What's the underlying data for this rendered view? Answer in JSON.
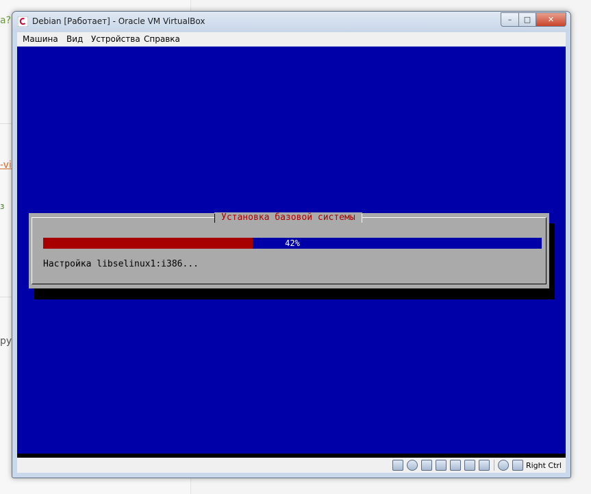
{
  "background": {
    "fragment_q": "а?",
    "fragment_link": "-vi",
    "fragment_g": "з",
    "fragment_ru": "ру"
  },
  "window": {
    "title": "Debian [Работает] - Oracle VM VirtualBox",
    "minimize_glyph": "–",
    "maximize_glyph": "□",
    "close_glyph": "✕"
  },
  "menu": {
    "items": [
      "Машина",
      "Вид",
      "Устройства",
      "Справка"
    ]
  },
  "installer": {
    "dialog_title": "Установка базовой системы",
    "progress_percent": 42,
    "progress_label": "42%",
    "status_text": "Настройка libselinux1:i386..."
  },
  "statusbar": {
    "icons": [
      "hard-disk-icon",
      "optical-disk-icon",
      "usb-icon",
      "network-icon",
      "shared-folders-icon",
      "video-capture-icon",
      "display-icon",
      "mouse-integration-icon",
      "keyboard-capture-icon"
    ],
    "host_key": "Right Ctrl"
  },
  "colors": {
    "screen_bg": "#0000a8",
    "progress_fill": "#a80000",
    "dialog_bg": "#aaaaaa",
    "dialog_title": "#a80000"
  }
}
